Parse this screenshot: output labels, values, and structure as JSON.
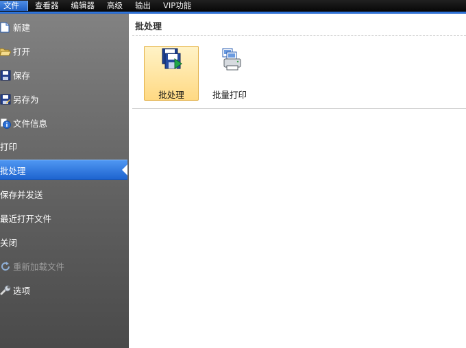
{
  "menubar": {
    "items": [
      {
        "label": "文件",
        "active": true
      },
      {
        "label": "查看器"
      },
      {
        "label": "编辑器"
      },
      {
        "label": "高级"
      },
      {
        "label": "输出"
      },
      {
        "label": "VIP功能"
      }
    ]
  },
  "sidebar": {
    "items": [
      {
        "label": "新建",
        "icon": "new-document-icon"
      },
      {
        "label": "打开",
        "icon": "open-folder-icon"
      },
      {
        "label": "保存",
        "icon": "floppy-disk-icon"
      },
      {
        "label": "另存为",
        "icon": "save-as-icon"
      },
      {
        "label": "文件信息",
        "icon": "info-icon"
      },
      {
        "label": "打印"
      },
      {
        "label": "批处理",
        "selected": true
      },
      {
        "label": "保存并发送"
      },
      {
        "label": "最近打开文件"
      },
      {
        "label": "关闭"
      },
      {
        "label": "重新加载文件",
        "icon": "reload-icon",
        "disabled": true
      },
      {
        "label": "选项",
        "icon": "wrench-icon"
      }
    ]
  },
  "main": {
    "title": "批处理",
    "tiles": [
      {
        "label": "批处理",
        "icon": "batch-save-icon",
        "active": true
      },
      {
        "label": "批量打印",
        "icon": "batch-print-icon"
      }
    ]
  },
  "colors": {
    "accent": "#1f60c8",
    "selected_item": "#3b82e6",
    "active_tile": "#ffd983"
  }
}
